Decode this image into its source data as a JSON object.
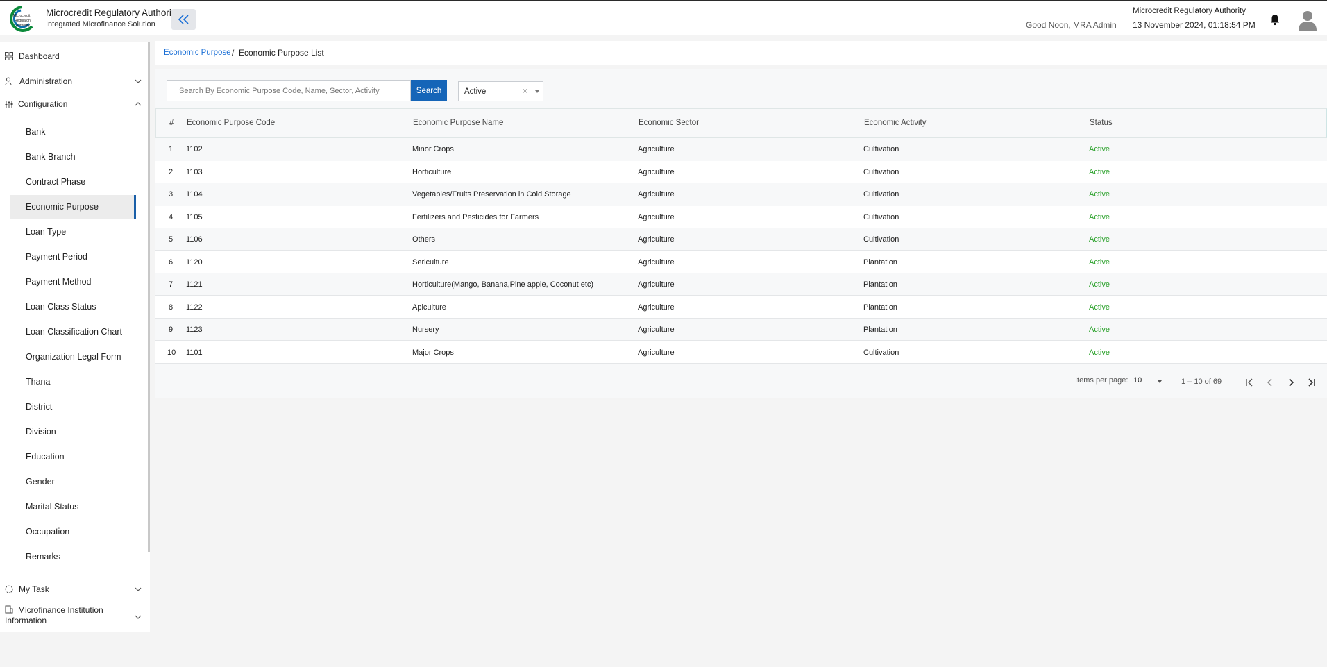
{
  "header": {
    "brand_title": "Microcredit Regulatory Authority",
    "brand_subtitle": "Integrated Microfinance Solution",
    "logo_text": "Microcredit Regulatory Authority",
    "greeting": "Good Noon, MRA Admin",
    "org_name": "Microcredit Regulatory Authority",
    "datetime": "13 November 2024, 01:18:54 PM"
  },
  "sidebar": {
    "dashboard": "Dashboard",
    "administration": "Administration",
    "configuration": "Configuration",
    "items": [
      {
        "label": "Bank"
      },
      {
        "label": "Bank Branch"
      },
      {
        "label": "Contract Phase"
      },
      {
        "label": "Economic Purpose",
        "active": true
      },
      {
        "label": "Loan Type"
      },
      {
        "label": "Payment Period"
      },
      {
        "label": "Payment Method"
      },
      {
        "label": "Loan Class Status"
      },
      {
        "label": "Loan Classification Chart"
      },
      {
        "label": "Organization Legal Form"
      },
      {
        "label": "Thana"
      },
      {
        "label": "District"
      },
      {
        "label": "Division"
      },
      {
        "label": "Education"
      },
      {
        "label": "Gender"
      },
      {
        "label": "Marital Status"
      },
      {
        "label": "Occupation"
      },
      {
        "label": "Remarks"
      }
    ],
    "my_task": "My Task",
    "mfi_info": "Microfinance Institution Information"
  },
  "breadcrumb": {
    "parent": "Economic Purpose",
    "separator": "/",
    "current": "Economic Purpose List"
  },
  "search": {
    "placeholder": "Search By Economic Purpose Code, Name, Sector, Activity",
    "button": "Search",
    "status_value": "Active",
    "clear": "×"
  },
  "table": {
    "headers": [
      "#",
      "Economic Purpose Code",
      "Economic Purpose Name",
      "Economic Sector",
      "Economic Activity",
      "Status"
    ],
    "rows": [
      [
        "1",
        "1102",
        "Minor Crops",
        "Agriculture",
        "Cultivation",
        "Active"
      ],
      [
        "2",
        "1103",
        "Horticulture",
        "Agriculture",
        "Cultivation",
        "Active"
      ],
      [
        "3",
        "1104",
        "Vegetables/Fruits Preservation in Cold Storage",
        "Agriculture",
        "Cultivation",
        "Active"
      ],
      [
        "4",
        "1105",
        "Fertilizers and Pesticides for Farmers",
        "Agriculture",
        "Cultivation",
        "Active"
      ],
      [
        "5",
        "1106",
        "Others",
        "Agriculture",
        "Cultivation",
        "Active"
      ],
      [
        "6",
        "1120",
        "Sericulture",
        "Agriculture",
        "Plantation",
        "Active"
      ],
      [
        "7",
        "1121",
        "Horticulture(Mango, Banana,Pine apple, Coconut etc)",
        "Agriculture",
        "Plantation",
        "Active"
      ],
      [
        "8",
        "1122",
        "Apiculture",
        "Agriculture",
        "Plantation",
        "Active"
      ],
      [
        "9",
        "1123",
        "Nursery",
        "Agriculture",
        "Plantation",
        "Active"
      ],
      [
        "10",
        "1101",
        "Major Crops",
        "Agriculture",
        "Cultivation",
        "Active"
      ]
    ]
  },
  "pagination": {
    "items_per_page_label": "Items per page:",
    "items_per_page": "10",
    "range": "1 – 10 of 69"
  },
  "colors": {
    "accent": "#1565b8",
    "link": "#1a6fd6",
    "status_active": "#28a028",
    "active_indicator": "#1a5fa8"
  }
}
